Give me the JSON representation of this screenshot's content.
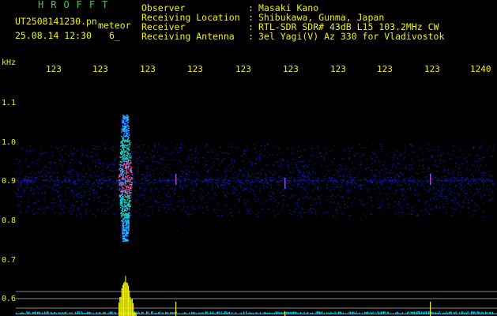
{
  "header": {
    "station_name": "HROFFT",
    "filename": "UT2508141230.pn",
    "event_type": "meteor",
    "datetime": "25.08.14 12:30",
    "count": "6_",
    "fields": [
      {
        "label": "Observer",
        "value": "Masaki Kano"
      },
      {
        "label": "Receiving Location",
        "value": "Shibukawa, Gunma, Japan"
      },
      {
        "label": "Receiver",
        "value": "RTL-SDR SDR# 43dB L15 103.2MHz CW"
      },
      {
        "label": "Receiving Antenna",
        "value": "3el Yagi(V) Az 330 for Vladivostok"
      }
    ]
  },
  "time_axis": {
    "labels": [
      "123",
      "123",
      "123",
      "123",
      "123",
      "123",
      "123",
      "123",
      "123",
      "1240"
    ]
  },
  "freq_axis": {
    "unit": "kHz",
    "labels": [
      "1.1",
      "1.0",
      "0.9",
      "0.8",
      "0.7",
      "0.6"
    ]
  },
  "colors": {
    "text": "#f2f200",
    "station": "#35d23a",
    "noise": "#1e1e96",
    "echo_core": "#ff2a6e",
    "echo_mid": "#18d08a",
    "echo_cyan": "#1ec8ff",
    "power_trace": "#f2f200",
    "baseline": "#00c8ff"
  }
}
